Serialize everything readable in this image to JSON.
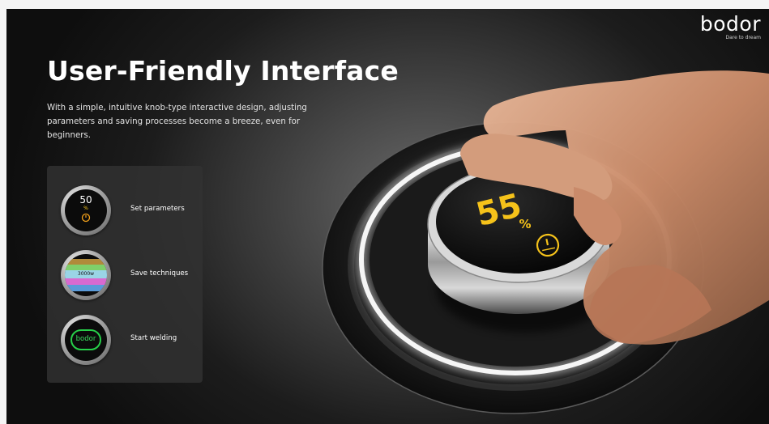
{
  "brand": {
    "logo": "bodor",
    "tagline": "Dare to dream"
  },
  "header": {
    "title": "User-Friendly Interface"
  },
  "description": "With a simple, intuitive knob-type interactive design, adjusting parameters and saving processes become a breeze, even for beginners.",
  "features": [
    {
      "label": "Set parameters",
      "icon": "knob-50-percent-icon",
      "value": "50",
      "unit": "%"
    },
    {
      "label": "Save techniques",
      "icon": "saved-techniques-list-icon",
      "value": "3000w"
    },
    {
      "label": "Start welding",
      "icon": "bodor-logo-start-icon",
      "value": "bodor"
    }
  ],
  "knob": {
    "value": "55",
    "unit": "%",
    "icon": "gauge-icon",
    "accent": "#f5c21a"
  },
  "colors": {
    "accent": "#f5c21a",
    "ring_glow": "#ffffff",
    "start_green": "#27d04a"
  }
}
